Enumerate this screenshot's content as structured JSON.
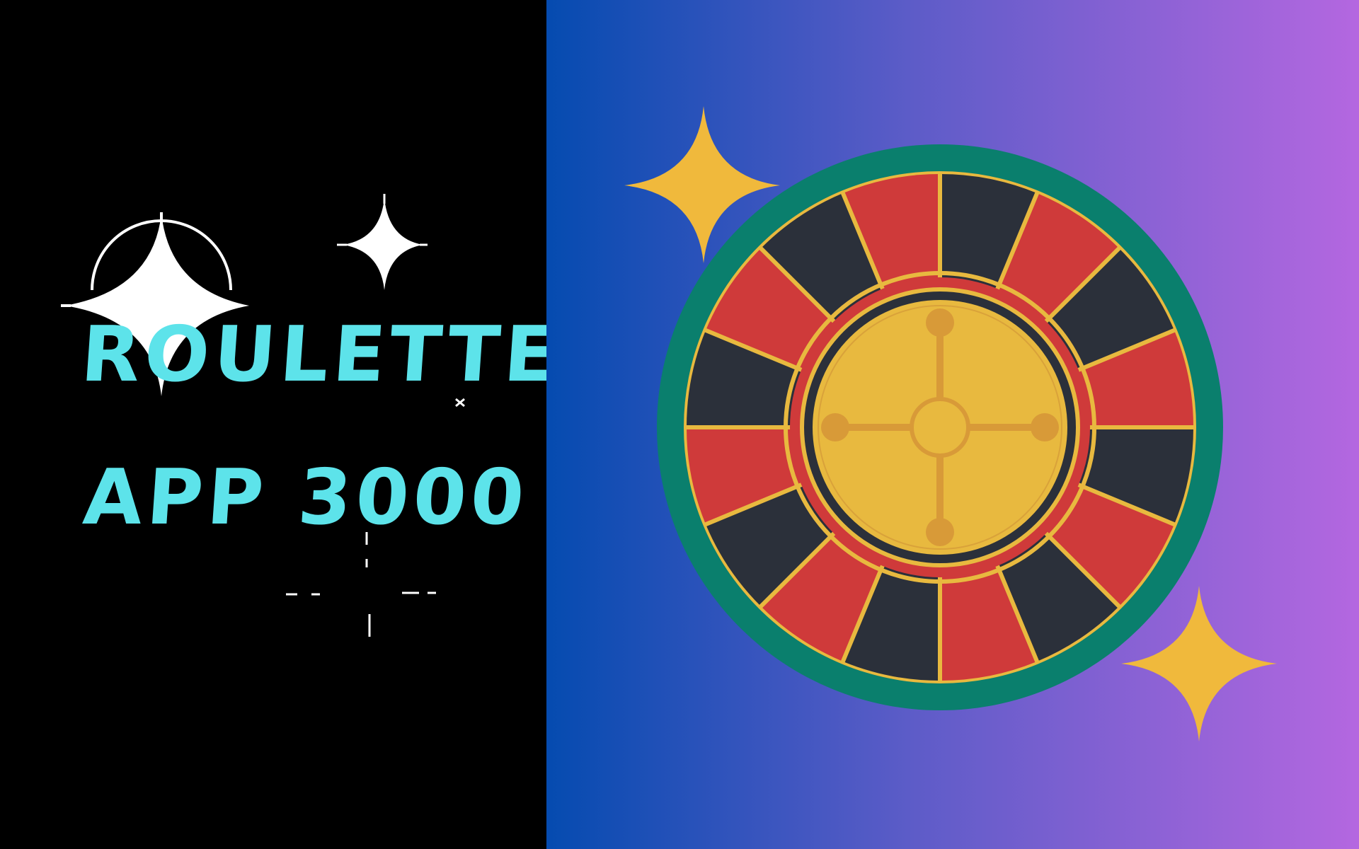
{
  "title": {
    "line1": "ROULETTE",
    "line2": "APP 3000"
  },
  "colors": {
    "title_text": "#5de3ea",
    "left_background": "#000000",
    "gradient_start": "#054bb0",
    "gradient_end": "#b467e0",
    "wheel_rim": "#0a7f6d",
    "wheel_red": "#cf3a3a",
    "wheel_black": "#2b303a",
    "wheel_gold": "#e8b93f",
    "sparkle_gold": "#f0b93c",
    "sparkle_white": "#ffffff"
  },
  "icons": {
    "wheel": "roulette-wheel-icon",
    "sparkle_gold": "sparkle-icon",
    "sparkle_white": "sparkle-icon"
  }
}
